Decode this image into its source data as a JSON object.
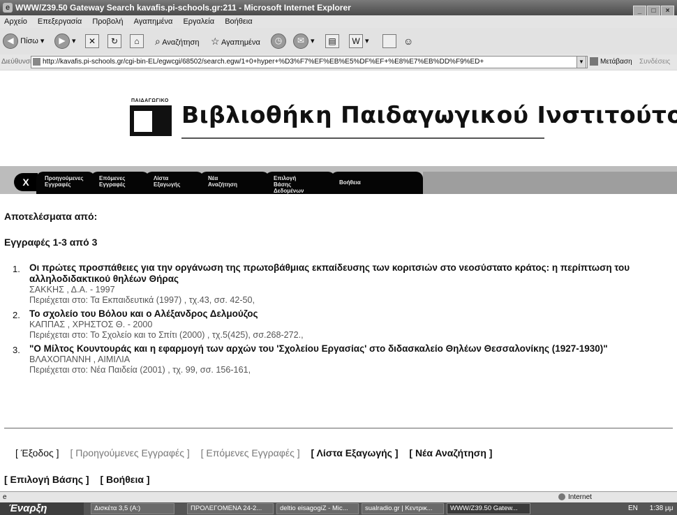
{
  "window": {
    "title": "WWW/Z39.50 Gateway Search kavafis.pi-schools.gr:211 - Microsoft Internet Explorer"
  },
  "menu": [
    "Αρχείο",
    "Επεξεργασία",
    "Προβολή",
    "Αγαπημένα",
    "Εργαλεία",
    "Βοήθεια"
  ],
  "toolbar": {
    "back_label": "Πίσω",
    "search_label": "Αναζήτηση",
    "favorites_label": "Αγαπημένα"
  },
  "address": {
    "label": "Διεύθυνση",
    "url": "http://kavafis.pi-schools.gr/cgi-bin-EL/egwcgi/68502/search.egw/1+0+hyper+%D3%F7%EF%EB%E5%DF%EF+%E8%E7%EB%DD%F9%ED+",
    "go_label": "Μετάβαση",
    "links_label": "Συνδέσεις"
  },
  "header": {
    "logo_small_text": "ΠΑΙΔΑΓΩΓΙΚΟ",
    "title": "Βιβλιοθήκη Παιδαγωγικού Ινστιτούτου"
  },
  "nav": {
    "close": "X",
    "tabs": [
      "Προηγούμενες\nΕγγραφές",
      "Επόμενες\nΕγγραφές",
      "Λίστα\nΕξαγωγής",
      "Νέα\nΑναζήτηση",
      "Επιλογή\nΒάσης\nΔεδομένων",
      "Βοήθεια"
    ]
  },
  "results": {
    "heading": "Αποτελέσματα από:",
    "range": "Εγγραφές 1-3 από 3",
    "items": [
      {
        "num": "1.",
        "title": "Οι πρώτες προσπάθειες για την οργάνωση της πρωτοβάθμιας εκπαίδευσης των κοριτσιών στο νεοσύστατο κράτος: η περίπτωση του αλληλοδιδακτικού θηλέων Θήρας",
        "author": "ΣΑΚΚΗΣ , Δ.Α. - 1997",
        "source": "Περιέχεται στο: Τα Εκπαιδευτικά (1997) , τχ.43, σσ. 42-50,"
      },
      {
        "num": "2.",
        "title": "Το σχολείο του Βόλου και ο Αλέξανδρος Δελμούζος",
        "author": "ΚΑΠΠΑΣ , ΧΡΗΣΤΟΣ Θ. - 2000",
        "source": "Περιέχεται στο: Το Σχολείο και το Σπίτι (2000) , τχ.5(425), σσ.268-272.,"
      },
      {
        "num": "3.",
        "title": "\"Ο Μίλτος Κουντουράς και η εφαρμογή των αρχών του 'Σχολείου Εργασίας' στο διδασκαλείο Θηλέων Θεσσαλονίκης (1927-1930)\"",
        "author": "ΒΛΑΧΟΠΑΝΝΗ , ΑΙΜΙΛΙΑ",
        "source": "Περιέχεται στο: Νέα Παιδεία (2001) , τχ. 99, σσ. 156-161,"
      }
    ]
  },
  "bottom_nav": {
    "exit": "[ Έξοδος ]",
    "prev": "[ Προηγούμενες Εγγραφές ]",
    "next": "[ Επόμενες Εγγραφές ]",
    "export": "[ Λίστα Εξαγωγής ]",
    "new_search": "[ Νέα Αναζήτηση ]",
    "select_db": "[ Επιλογή Βάσης ]",
    "help": "[ Βοήθεια ]"
  },
  "status": {
    "zone": "Internet"
  },
  "taskbar": {
    "start": "Έναρξη",
    "tasks": [
      "Δισκέτα 3,5 (A:)",
      "ΠΡΟΛΕΓΟΜΕΝΑ 24-2...",
      "deltio eisagogiZ - Mic...",
      "sualradio.gr | Κεντρικ...",
      "WWW/Z39.50 Gatew..."
    ],
    "lang": "EN",
    "time": "1:38 μμ"
  }
}
